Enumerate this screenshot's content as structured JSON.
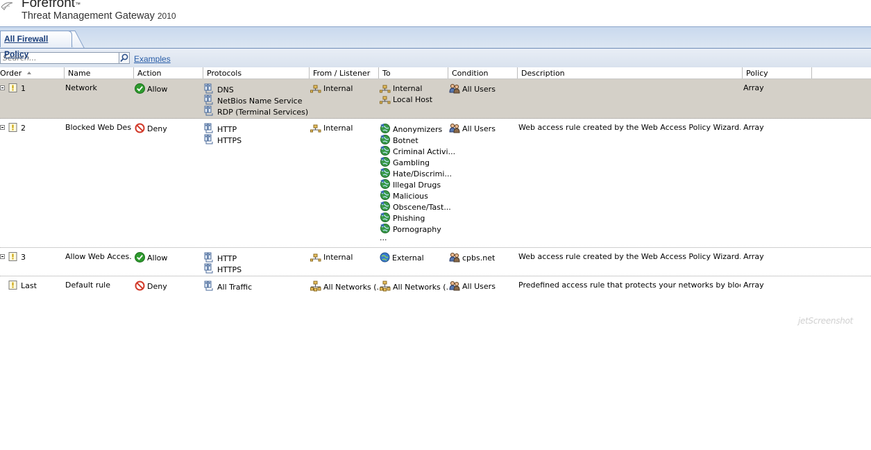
{
  "header": {
    "brand": "Forefront",
    "brand_mark": "™",
    "product": "Threat Management Gateway",
    "year": "2010"
  },
  "tabs": [
    {
      "label": "All Firewall Policy"
    }
  ],
  "search": {
    "placeholder": "Search...",
    "examples_label": "Examples"
  },
  "columns": {
    "order": "Order",
    "name": "Name",
    "action": "Action",
    "protocols": "Protocols",
    "from": "From / Listener",
    "to": "To",
    "condition": "Condition",
    "description": "Description",
    "policy": "Policy"
  },
  "rules": [
    {
      "order": "1",
      "name": "Network",
      "action": "Allow",
      "protocols": [
        "DNS",
        "NetBios Name Service",
        "RDP (Terminal Services)"
      ],
      "from": [
        "Internal"
      ],
      "to": [
        "Internal",
        "Local Host"
      ],
      "condition": "All Users",
      "description": "",
      "policy": "Array"
    },
    {
      "order": "2",
      "name": "Blocked Web Des...",
      "action": "Deny",
      "protocols": [
        "HTTP",
        "HTTPS"
      ],
      "from": [
        "Internal"
      ],
      "to": [
        "Anonymizers",
        "Botnet",
        "Criminal Activi...",
        "Gambling",
        "Hate/Discrimi...",
        "Illegal Drugs",
        "Malicious",
        "Obscene/Tast...",
        "Phishing",
        "Pornography"
      ],
      "to_more": "...",
      "condition": "All Users",
      "description": "Web access rule created by the Web Access Policy Wizard.",
      "policy": "Array"
    },
    {
      "order": "3",
      "name": "Allow Web Acces...",
      "action": "Allow",
      "protocols": [
        "HTTP",
        "HTTPS"
      ],
      "from": [
        "Internal"
      ],
      "to": [
        "External"
      ],
      "condition": "cpbs.net",
      "description": "Web access rule created by the Web Access Policy Wizard.",
      "policy": "Array"
    },
    {
      "order": "Last",
      "name": "Default rule",
      "action": "Deny",
      "protocols": [
        "All Traffic"
      ],
      "from": [
        "All Networks (..."
      ],
      "to": [
        "All Networks (..."
      ],
      "condition": "All Users",
      "description": "Predefined access rule that protects your networks by blocking ...",
      "policy": "Array"
    }
  ],
  "icons": {
    "allow": "allow-check-icon",
    "deny": "deny-icon",
    "protocol": "protocol-icon",
    "network": "network-icon",
    "url-category": "url-category-icon",
    "globe": "globe-icon",
    "users": "users-icon",
    "rule": "rule-icon"
  },
  "colors": {
    "allow": "#2e9a2e",
    "deny": "#d23a2a",
    "row_selected": "#d4d0c8",
    "link": "#2a5ea8",
    "tab_text": "#1a3e7a"
  },
  "watermark": "jetScreenshot"
}
